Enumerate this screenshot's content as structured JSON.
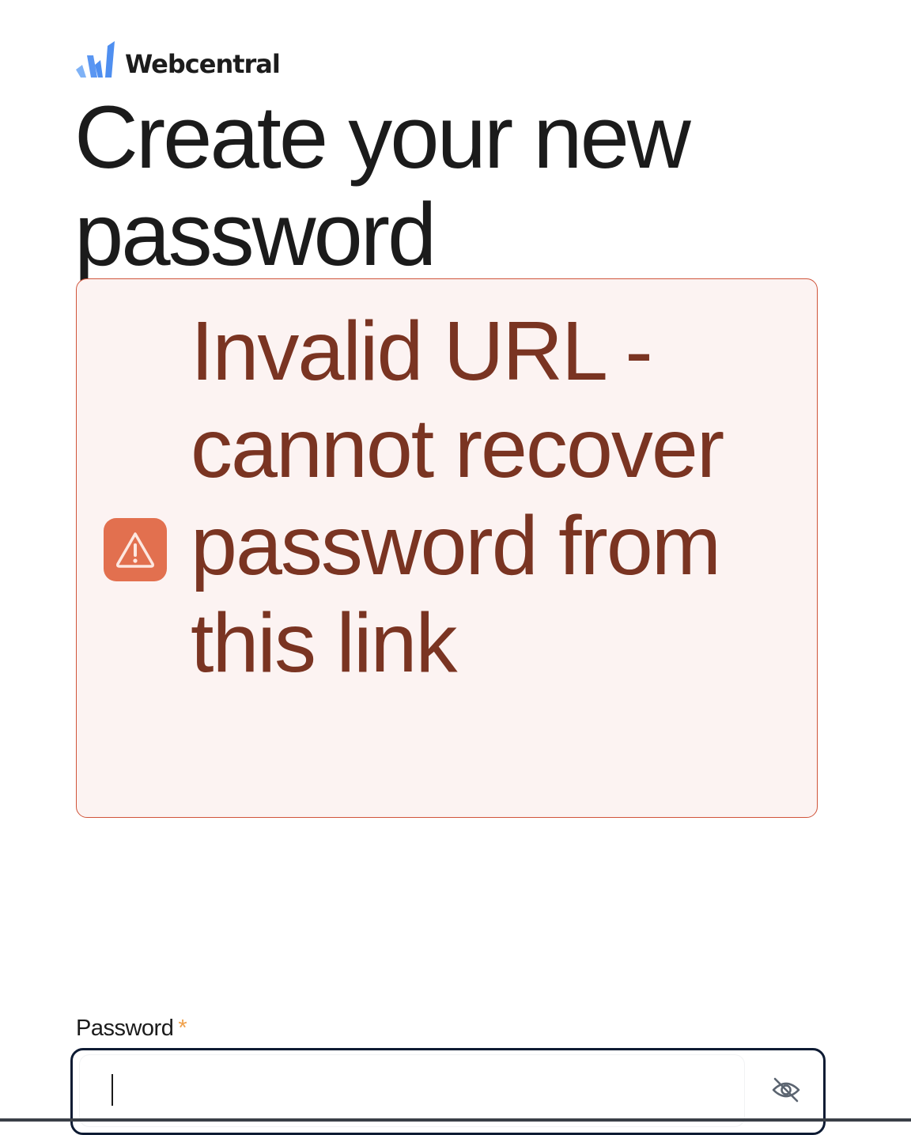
{
  "brand": {
    "name": "Webcentral",
    "logo_icon": "webcentral-w-logo",
    "colors": {
      "logo_blue": "#4f8ff0",
      "logo_light_blue": "#7fb2f6"
    }
  },
  "page": {
    "title": "Create your new password"
  },
  "alert": {
    "icon": "warning-triangle-icon",
    "message": "Invalid URL - cannot recover password from this link",
    "colors": {
      "background": "#fcf3f2",
      "border": "#d0543a",
      "text": "#7a3422",
      "icon_background": "#e2704f"
    }
  },
  "form": {
    "password": {
      "label": "Password",
      "required_marker": "*",
      "value": "",
      "toggle_icon": "eye-off-icon"
    }
  }
}
